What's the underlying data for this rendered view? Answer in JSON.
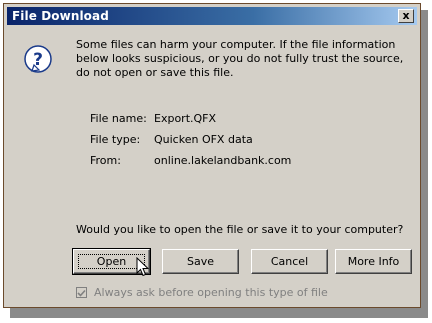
{
  "window": {
    "title": "File Download",
    "close_glyph": "x"
  },
  "dialog": {
    "warning_text": "Some files can harm your computer. If the file information below looks suspicious, or you do not fully trust the source, do not open or save this file.",
    "file_info": [
      {
        "label": "File name:",
        "value": "Export.QFX"
      },
      {
        "label": "File type:",
        "value": "Quicken OFX data"
      },
      {
        "label": "From:",
        "value": "online.lakelandbank.com"
      }
    ],
    "question": "Would you like to open the file or save it to your computer?",
    "buttons": {
      "open": "Open",
      "save": "Save",
      "cancel": "Cancel",
      "more_info": "More Info"
    },
    "checkbox": {
      "label": "Always ask before opening this type of file",
      "checked": true,
      "enabled": false
    }
  },
  "colors": {
    "titlebar_start": "#0a246a",
    "titlebar_end": "#a6caf0",
    "dialog_bg": "#d4d0c8"
  },
  "icons": {
    "help": "question-icon",
    "cursor": "arrow-cursor-icon"
  }
}
